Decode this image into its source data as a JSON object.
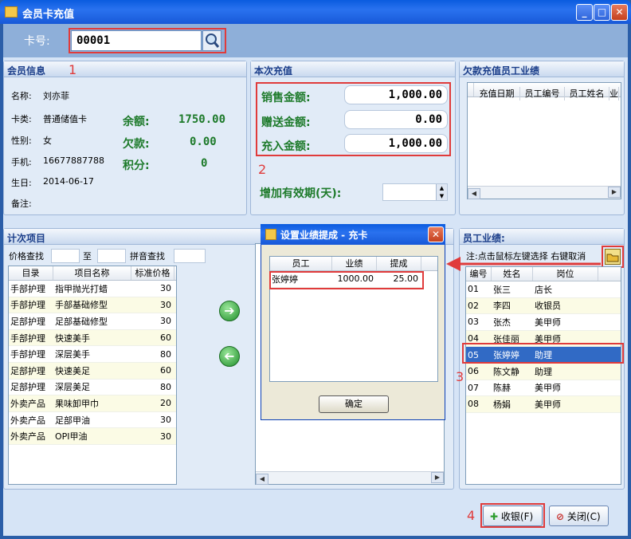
{
  "window": {
    "title": "会员卡充值"
  },
  "card": {
    "label": "卡号:",
    "value": "00001"
  },
  "member": {
    "header": "会员信息",
    "name_label": "名称:",
    "name": "刘亦菲",
    "type_label": "卡类:",
    "type": "普通储值卡",
    "gender_label": "性别:",
    "gender": "女",
    "phone_label": "手机:",
    "phone": "16677887788",
    "birthday_label": "生日:",
    "birthday": "2014-06-17",
    "note_label": "备注:",
    "balance_label": "余额:",
    "balance": "1750.00",
    "debt_label": "欠款:",
    "debt": "0.00",
    "points_label": "积分:",
    "points": "0"
  },
  "recharge": {
    "header": "本次充值",
    "sale_label": "销售金额:",
    "sale": "1,000.00",
    "gift_label": "赠送金额:",
    "gift": "0.00",
    "charge_label": "充入金额:",
    "charge": "1,000.00",
    "validity_label": "增加有效期(天):"
  },
  "owe": {
    "header": "欠款充值员工业绩",
    "columns": [
      "充值日期",
      "员工编号",
      "员工姓名",
      "业"
    ]
  },
  "count_items": {
    "header": "计次项目",
    "price_search": "价格查找",
    "to": "至",
    "pinyin_search": "拼音查找",
    "columns": [
      "目录",
      "项目名称",
      "标准价格"
    ],
    "rows": [
      [
        "手部护理",
        "指甲抛光打蜡",
        "30"
      ],
      [
        "手部护理",
        "手部基础修型",
        "30"
      ],
      [
        "足部护理",
        "足部基础修型",
        "30"
      ],
      [
        "手部护理",
        "快速美手",
        "60"
      ],
      [
        "手部护理",
        "深层美手",
        "80"
      ],
      [
        "足部护理",
        "快速美足",
        "60"
      ],
      [
        "足部护理",
        "深层美足",
        "80"
      ],
      [
        "外卖产品",
        "果味卸甲巾",
        "20"
      ],
      [
        "外卖产品",
        "足部甲油",
        "30"
      ],
      [
        "外卖产品",
        "OPI甲油",
        "30"
      ]
    ],
    "add_arrow": "➔",
    "remove_arrow": "➔"
  },
  "employees": {
    "header": "员工业绩:",
    "hint": "注:点击鼠标左键选择 右键取消",
    "columns": [
      "编号",
      "姓名",
      "岗位"
    ],
    "rows": [
      [
        "01",
        "张三",
        "店长"
      ],
      [
        "02",
        "李四",
        "收银员"
      ],
      [
        "03",
        "张杰",
        "美甲师"
      ],
      [
        "04",
        "张佳丽",
        "美甲师"
      ],
      [
        "05",
        "张婷婷",
        "助理"
      ],
      [
        "06",
        "陈文静",
        "助理"
      ],
      [
        "07",
        "陈赫",
        "美甲师"
      ],
      [
        "08",
        "杨娟",
        "美甲师"
      ]
    ],
    "selected_index": 4
  },
  "dialog": {
    "title": "设置业绩提成 - 充卡",
    "columns": [
      "员工",
      "业绩",
      "提成"
    ],
    "row": [
      "张婷婷",
      "1000.00",
      "25.00"
    ],
    "ok_label": "确定"
  },
  "footer": {
    "checkout_label": "收银(F)",
    "close_label": "关闭(C)"
  },
  "annotations": [
    "1",
    "2",
    "3",
    "4"
  ],
  "colors": {
    "highlight": "#e03b3b",
    "accent_green": "#1d7a2a",
    "selection": "#316ac5"
  }
}
